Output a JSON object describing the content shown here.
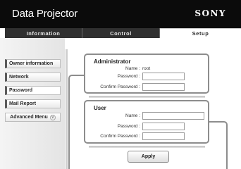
{
  "header": {
    "title": "Data Projector",
    "brand": "SONY"
  },
  "tabs": [
    {
      "label": "Information",
      "active": false
    },
    {
      "label": "Control",
      "active": false
    },
    {
      "label": "Setup",
      "active": true
    }
  ],
  "sidebar": {
    "items": [
      {
        "label": "Owner information"
      },
      {
        "label": "Network"
      },
      {
        "label": "Password",
        "active": true
      },
      {
        "label": "Mail Report"
      },
      {
        "label": "Advanced Menu",
        "icon": "chevron-down-icon"
      }
    ]
  },
  "administrator": {
    "title": "Administrator",
    "name_label": "Name :",
    "name_value": "root",
    "password_label": "Password :",
    "password_value": "",
    "confirm_label": "Confirm Password :",
    "confirm_value": ""
  },
  "user": {
    "title": "User",
    "name_label": "Name :",
    "name_value": "",
    "password_label": "Password :",
    "password_value": "",
    "confirm_label": "Confirm Password :",
    "confirm_value": ""
  },
  "actions": {
    "apply_label": "Apply"
  },
  "colors": {
    "header_bg": "#0b0b0b",
    "tab_bg": "#303030",
    "panel_border": "#8d8d8d"
  }
}
